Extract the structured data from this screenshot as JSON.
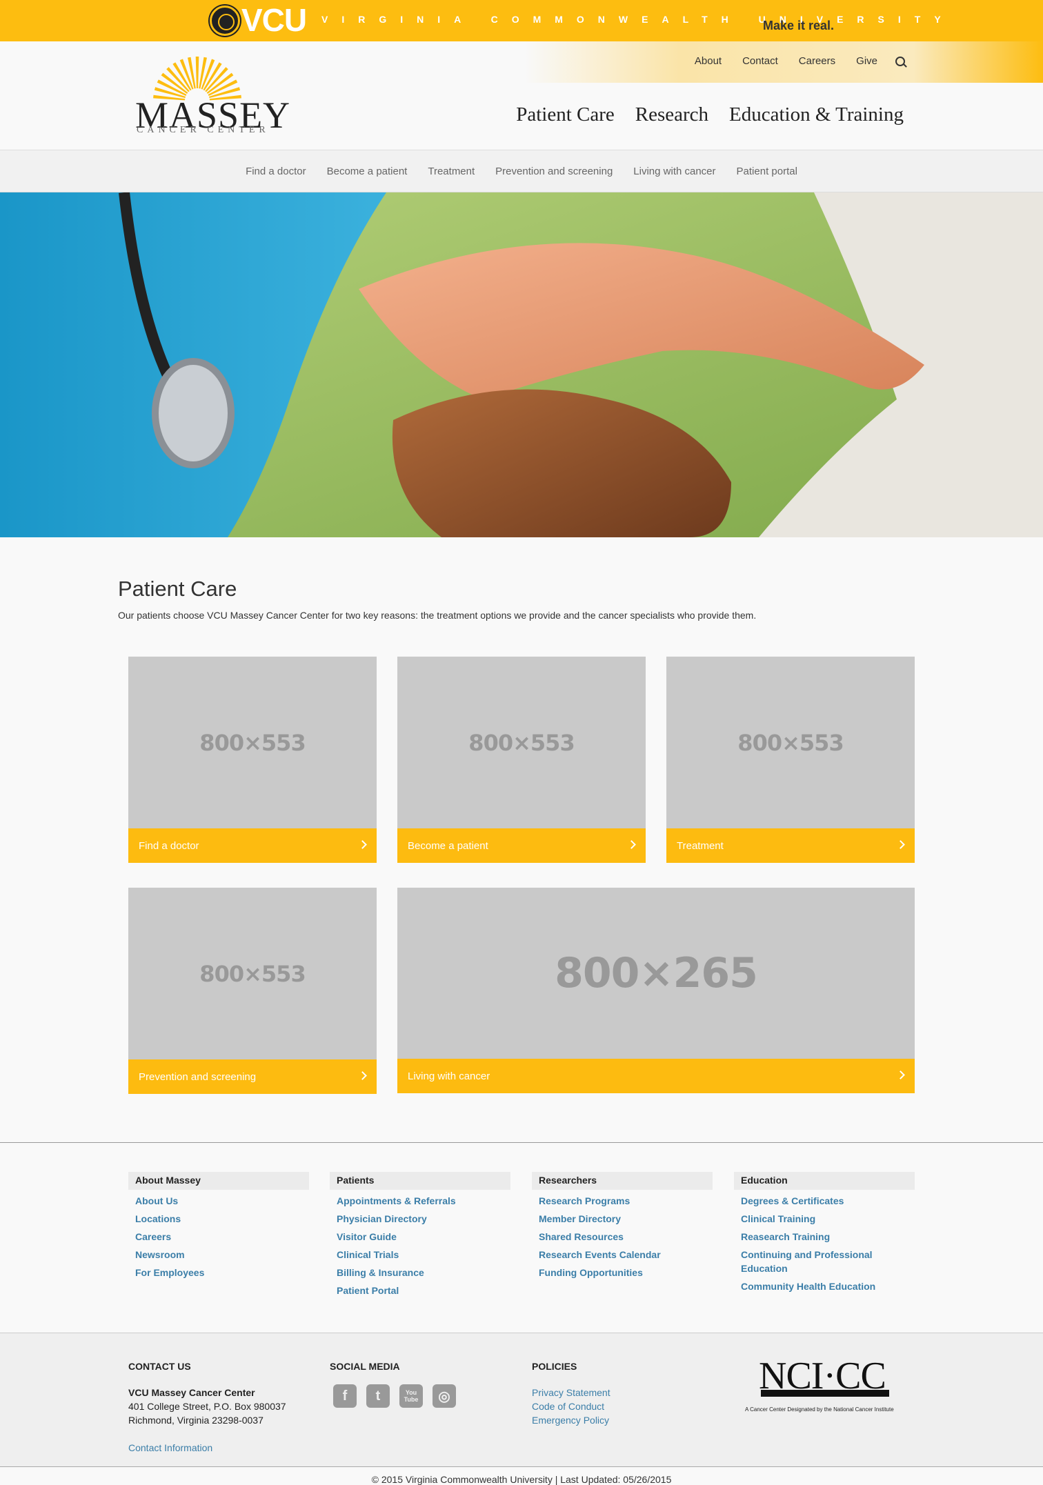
{
  "vcu": {
    "logo": "VCU",
    "name": "VIRGINIA COMMONWEALTH UNIVERSITY",
    "tagline": "Make it real."
  },
  "utility_nav": [
    "About",
    "Contact",
    "Careers",
    "Give"
  ],
  "logo": {
    "name": "MASSEY",
    "subtitle": "CANCER CENTER"
  },
  "main_nav": [
    "Patient Care",
    "Research",
    "Education & Training"
  ],
  "sub_nav": [
    "Find a doctor",
    "Become a patient",
    "Treatment",
    "Prevention and screening",
    "Living with cancer",
    "Patient portal"
  ],
  "intro": {
    "title": "Patient Care",
    "text": "Our patients choose VCU Massey Cancer Center for two key reasons: the treatment options we provide and the cancer specialists who provide them."
  },
  "cards": [
    {
      "placeholder": "800×553",
      "label": "Find a doctor"
    },
    {
      "placeholder": "800×553",
      "label": "Become a patient"
    },
    {
      "placeholder": "800×553",
      "label": "Treatment"
    },
    {
      "placeholder": "800×553",
      "label": "Prevention and screening"
    },
    {
      "placeholder": "800×265",
      "label": "Living with cancer"
    }
  ],
  "footer_columns": [
    {
      "heading": "About Massey",
      "links": [
        "About Us",
        "Locations",
        "Careers",
        "Newsroom",
        "For Employees"
      ]
    },
    {
      "heading": "Patients",
      "links": [
        "Appointments & Referrals",
        "Physician Directory",
        "Visitor Guide",
        "Clinical Trials",
        "Billing & Insurance",
        "Patient Portal"
      ]
    },
    {
      "heading": "Researchers",
      "links": [
        "Research Programs",
        "Member Directory",
        "Shared Resources",
        "Research Events Calendar",
        "Funding Opportunities"
      ]
    },
    {
      "heading": "Education",
      "links": [
        "Degrees & Certificates",
        "Clinical Training",
        "Reasearch Training",
        "Continuing and Professional Education",
        "Community Health Education"
      ]
    }
  ],
  "contact": {
    "heading": "CONTACT US",
    "org": "VCU Massey Cancer Center",
    "address1": "401 College Street, P.O. Box 980037",
    "address2": "Richmond, Virginia 23298-0037",
    "link": "Contact Information"
  },
  "social": {
    "heading": "SOCIAL MEDIA",
    "icons": [
      {
        "name": "facebook-icon",
        "glyph": "f"
      },
      {
        "name": "twitter-icon",
        "glyph": "t"
      },
      {
        "name": "youtube-icon",
        "glyph": "You Tube"
      },
      {
        "name": "instagram-icon",
        "glyph": "◎"
      }
    ]
  },
  "policies": {
    "heading": "POLICIES",
    "links": [
      "Privacy Statement",
      "Code of Conduct",
      "Emergency Policy"
    ]
  },
  "nci": {
    "logo": "NCI·CC",
    "caption": "A Cancer Center Designated by the National Cancer Institute"
  },
  "copyright": "© 2015 Virginia Commonwealth University | Last Updated: 05/26/2015",
  "colors": {
    "gold": "#fdbd10",
    "link": "#3b7ea8"
  }
}
